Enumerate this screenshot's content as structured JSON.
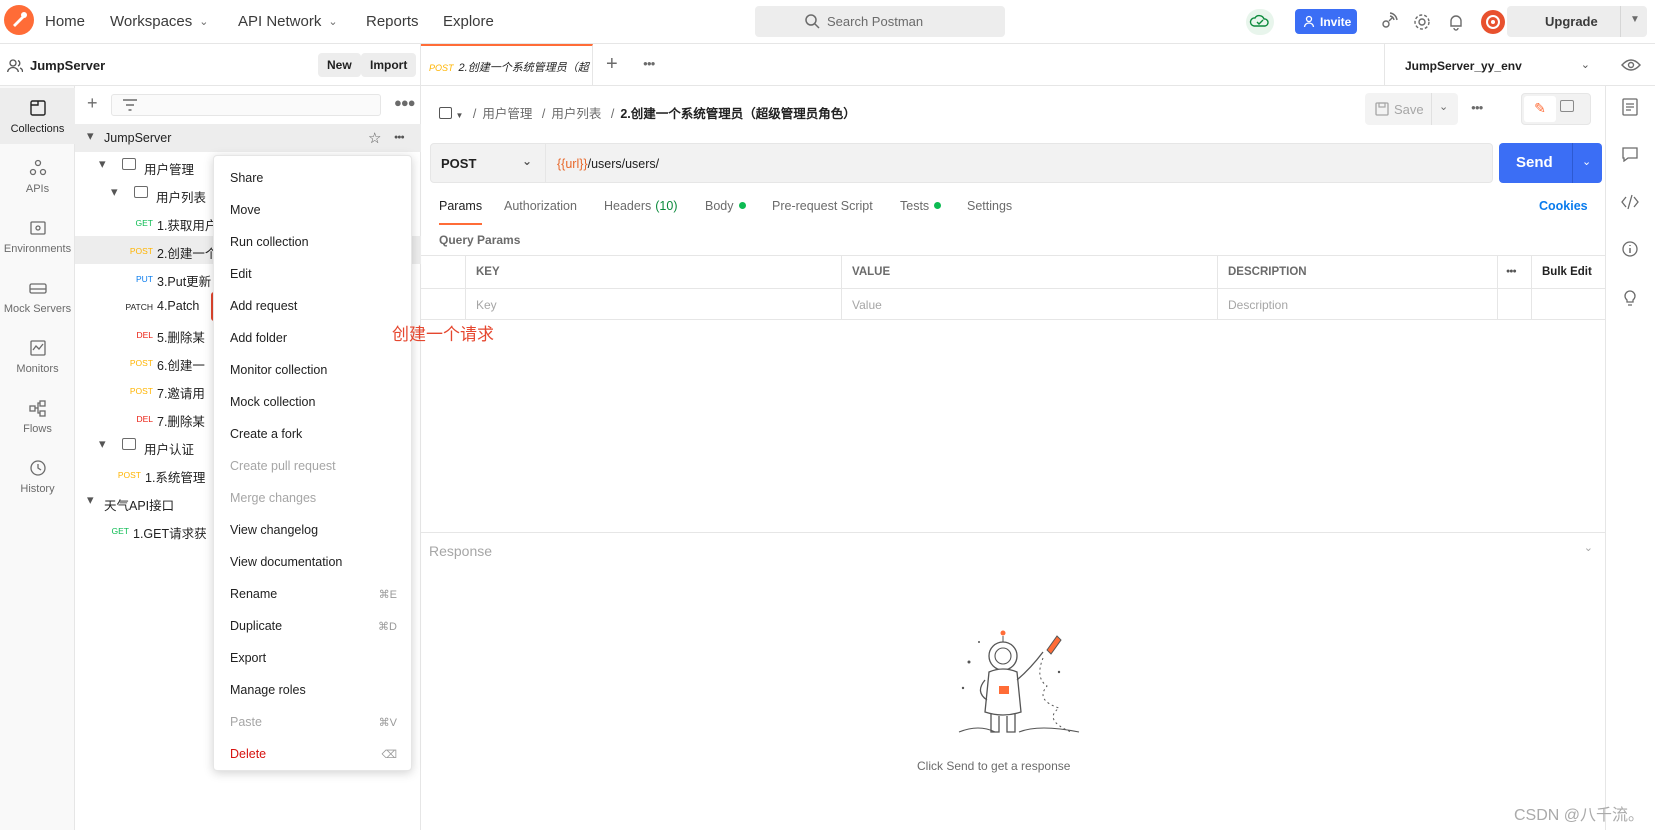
{
  "topbar": {
    "nav": [
      {
        "label": "Home",
        "caret": false
      },
      {
        "label": "Workspaces",
        "caret": true
      },
      {
        "label": "API Network",
        "caret": true
      },
      {
        "label": "Reports",
        "caret": false
      },
      {
        "label": "Explore",
        "caret": false
      }
    ],
    "search_placeholder": "Search Postman",
    "invite": "Invite",
    "upgrade": "Upgrade"
  },
  "workspace": {
    "name": "JumpServer",
    "new": "New",
    "import": "Import"
  },
  "rail": [
    {
      "label": "Collections",
      "icon": "collections-icon",
      "active": true
    },
    {
      "label": "APIs",
      "icon": "apis-icon"
    },
    {
      "label": "Environments",
      "icon": "environments-icon"
    },
    {
      "label": "Mock Servers",
      "icon": "mock-servers-icon"
    },
    {
      "label": "Monitors",
      "icon": "monitors-icon"
    },
    {
      "label": "Flows",
      "icon": "flows-icon"
    },
    {
      "label": "History",
      "icon": "history-icon"
    }
  ],
  "tree": [
    {
      "type": "collection",
      "label": "JumpServer",
      "level": 0,
      "open": true,
      "selected": true
    },
    {
      "type": "folder",
      "label": "用户管理",
      "level": 1,
      "open": true
    },
    {
      "type": "folder",
      "label": "用户列表",
      "level": 2,
      "open": true
    },
    {
      "type": "req",
      "method": "GET",
      "label": "1.获取用户",
      "level": 3
    },
    {
      "type": "req",
      "method": "POST",
      "label": "2.创建一个",
      "level": 3,
      "active": true
    },
    {
      "type": "req",
      "method": "PUT",
      "label": "3.Put更新",
      "level": 3
    },
    {
      "type": "req",
      "method": "PATCH",
      "label": "4.Patch",
      "level": 3
    },
    {
      "type": "req",
      "method": "DEL",
      "label": "5.删除某",
      "level": 3
    },
    {
      "type": "req",
      "method": "POST",
      "label": "6.创建一",
      "level": 3
    },
    {
      "type": "req",
      "method": "POST",
      "label": "7.邀请用",
      "level": 3
    },
    {
      "type": "req",
      "method": "DEL",
      "label": "7.删除某",
      "level": 3
    },
    {
      "type": "folder",
      "label": "用户认证",
      "level": 1,
      "open": true
    },
    {
      "type": "req",
      "method": "POST",
      "label": "1.系统管理",
      "level": 2
    },
    {
      "type": "collection",
      "label": "天气API接口",
      "level": 0,
      "open": true
    },
    {
      "type": "req",
      "method": "GET",
      "label": "1.GET请求获",
      "level": 1
    }
  ],
  "context_menu": [
    {
      "label": "Share"
    },
    {
      "label": "Move"
    },
    {
      "label": "Run collection"
    },
    {
      "label": "Edit"
    },
    {
      "label": "Add request",
      "highlight": true
    },
    {
      "label": "Add folder"
    },
    {
      "label": "Monitor collection"
    },
    {
      "label": "Mock collection"
    },
    {
      "label": "Create a fork"
    },
    {
      "label": "Create pull request",
      "disabled": true
    },
    {
      "label": "Merge changes",
      "disabled": true
    },
    {
      "label": "View changelog"
    },
    {
      "label": "View documentation"
    },
    {
      "label": "Rename",
      "shortcut": "⌘E"
    },
    {
      "label": "Duplicate",
      "shortcut": "⌘D"
    },
    {
      "label": "Export"
    },
    {
      "label": "Manage roles"
    },
    {
      "label": "Paste",
      "shortcut": "⌘V",
      "disabled": true
    },
    {
      "label": "Delete",
      "shortcut": "⌫",
      "danger": true
    }
  ],
  "annotation": "创建一个请求",
  "tab": {
    "method": "POST",
    "title": "2.创建一个系统管理员（超"
  },
  "environment": "JumpServer_yy_env",
  "breadcrumb": {
    "parts": [
      "用户管理",
      "用户列表"
    ],
    "current": "2.创建一个系统管理员（超级管理员角色）"
  },
  "save": "Save",
  "request": {
    "method": "POST",
    "url_var": "{{url}}",
    "url_path": "/users/users/",
    "send": "Send"
  },
  "req_tabs": [
    {
      "label": "Params",
      "active": true
    },
    {
      "label": "Authorization"
    },
    {
      "label": "Headers",
      "count": "(10)"
    },
    {
      "label": "Body",
      "dot": true
    },
    {
      "label": "Pre-request Script"
    },
    {
      "label": "Tests",
      "dot": true
    },
    {
      "label": "Settings"
    }
  ],
  "cookies": "Cookies",
  "query_params": {
    "title": "Query Params",
    "columns": [
      "KEY",
      "VALUE",
      "DESCRIPTION"
    ],
    "bulk_edit": "Bulk Edit",
    "placeholders": [
      "Key",
      "Value",
      "Description"
    ]
  },
  "response": {
    "title": "Response",
    "hint": "Click Send to get a response"
  },
  "watermark": "CSDN @八千流。",
  "colors": {
    "accent": "#ff6c37",
    "primary": "#3b6ef5",
    "annotation": "#e5472f"
  }
}
